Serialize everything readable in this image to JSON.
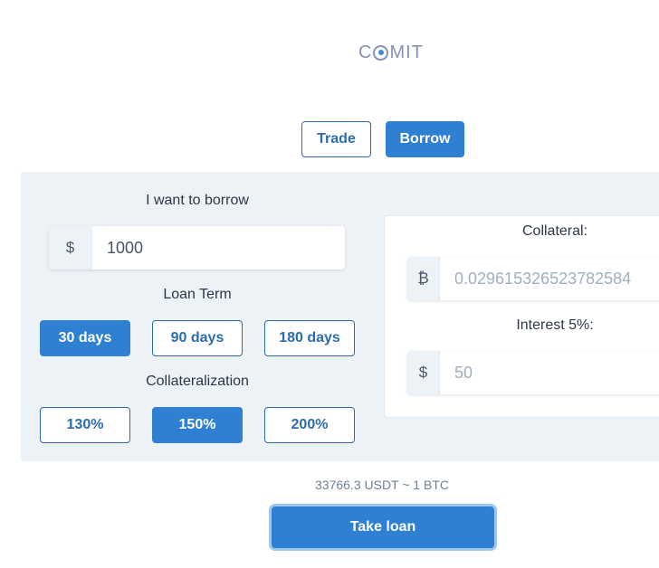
{
  "header": {
    "logo_left": "C",
    "logo_right": "MIT"
  },
  "tabs": {
    "trade": "Trade",
    "borrow": "Borrow"
  },
  "borrow_form": {
    "amount_label": "I want to borrow",
    "currency_symbol": "$",
    "amount_value": "1000",
    "loan_term_label": "Loan Term",
    "loan_terms": [
      "30 days",
      "90 days",
      "180 days"
    ],
    "selected_term": "30 days",
    "collateralization_label": "Collateralization",
    "collateralization_options": [
      "130%",
      "150%",
      "200%"
    ],
    "selected_collateralization": "150%"
  },
  "summary": {
    "collateral_label": "Collateral:",
    "collateral_symbol": "₿",
    "collateral_value": "0.029615326523782584",
    "interest_label": "Interest 5%:",
    "interest_symbol": "$",
    "interest_value": "50"
  },
  "rate_text": "33766.3 USDT ~ 1 BTC",
  "actions": {
    "take_loan": "Take loan"
  },
  "colors": {
    "primary": "#2f80d3",
    "panel_bg": "#edf2f7",
    "logo": "#8a90b4"
  }
}
